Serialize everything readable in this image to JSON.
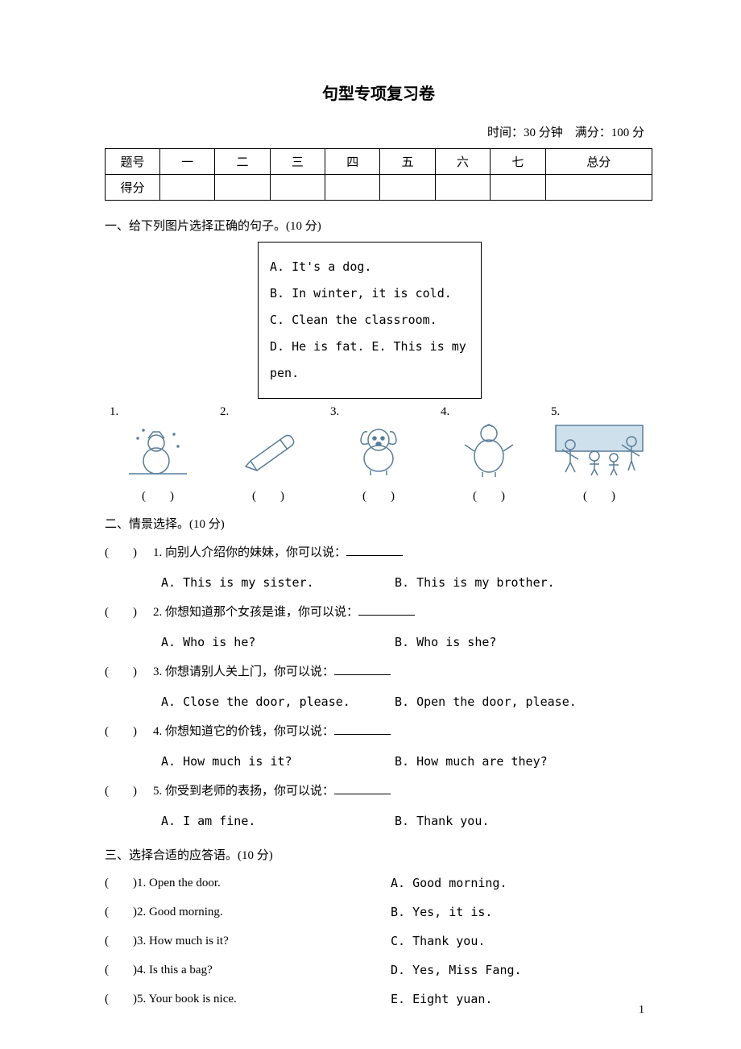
{
  "title": "句型专项复习卷",
  "timing": "时间：30 分钟　满分：100 分",
  "scoreTable": {
    "row1": [
      "题号",
      "一",
      "二",
      "三",
      "四",
      "五",
      "六",
      "七",
      "总分"
    ],
    "row2Label": "得分"
  },
  "section1": {
    "head": "一、给下列图片选择正确的句子。(10 分)",
    "choices": {
      "a": "A. It's a dog.",
      "b": "B. In winter, it is cold.",
      "c": "C. Clean the classroom.",
      "de": "D. He is fat. E. This is my pen."
    },
    "nums": [
      "1.",
      "2.",
      "3.",
      "4.",
      "5."
    ],
    "blank": "(　　)"
  },
  "section2": {
    "head": "二、情景选择。(10 分)",
    "items": [
      {
        "paren": "(　　)",
        "q": "1. 向别人介绍你的妹妹，你可以说：",
        "a": "A. This is my sister.",
        "b": "B. This is my brother."
      },
      {
        "paren": "(　　)",
        "q": "2. 你想知道那个女孩是谁，你可以说：",
        "a": "A. Who is he?",
        "b": "B. Who is she?"
      },
      {
        "paren": "(　　)",
        "q": "3. 你想请别人关上门，你可以说：",
        "a": "A. Close the door, please.",
        "b": "B. Open the door, please."
      },
      {
        "paren": "(　　)",
        "q": "4. 你想知道它的价钱，你可以说：",
        "a": "A. How much is it?",
        "b": "B. How much are they?"
      },
      {
        "paren": "(　　)",
        "q": "5. 你受到老师的表扬，你可以说：",
        "a": "A. I am fine.",
        "b": "B. Thank you."
      }
    ]
  },
  "section3": {
    "head": "三、选择合适的应答语。(10 分)",
    "items": [
      {
        "paren": "(　　)",
        "l": "1. Open the door.",
        "r": "A. Good morning."
      },
      {
        "paren": "(　　)",
        "l": "2. Good morning.",
        "r": "B. Yes, it is."
      },
      {
        "paren": "(　　)",
        "l": "3. How much is it?",
        "r": "C. Thank you."
      },
      {
        "paren": "(　　)",
        "l": "4. Is this a bag?",
        "r": "D. Yes, Miss Fang."
      },
      {
        "paren": "(　　)",
        "l": "5. Your book is nice.",
        "r": "E. Eight yuan."
      }
    ]
  },
  "pageNum": "1"
}
